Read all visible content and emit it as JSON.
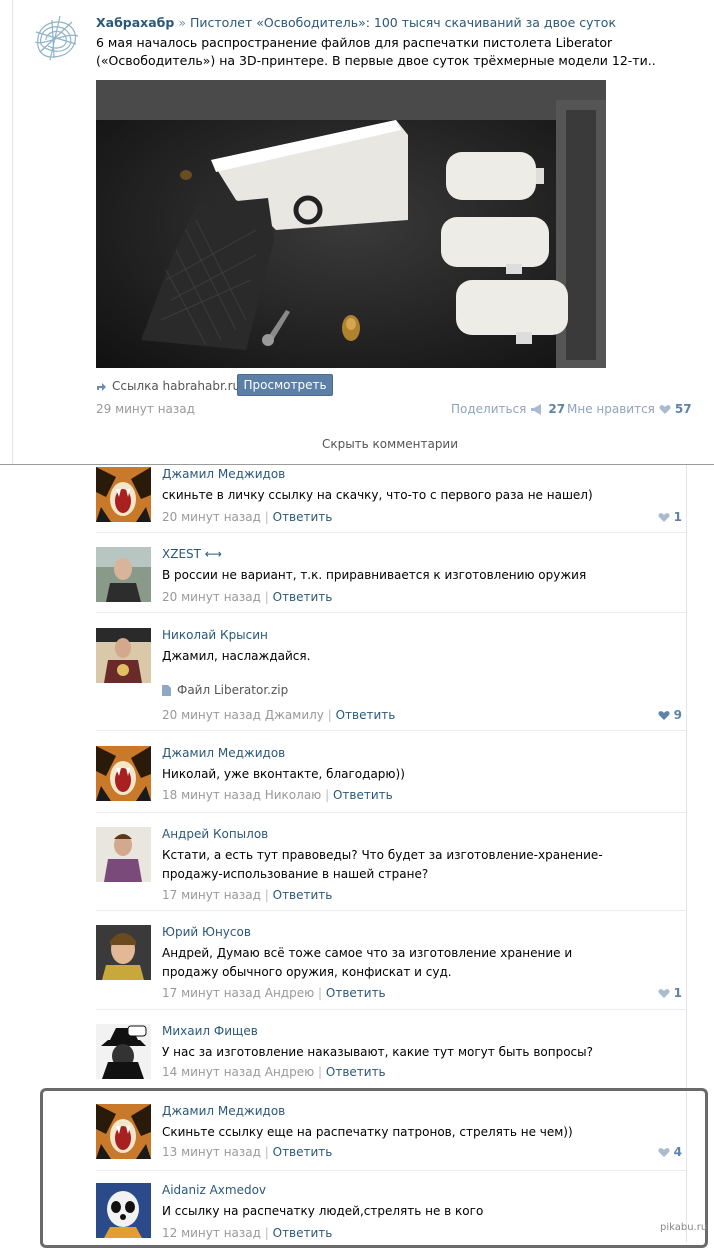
{
  "post": {
    "author": "Хабрахабр",
    "separator": "»",
    "title": "Пистолет «Освободитель»: 100 тысяч скачиваний за двое суток",
    "text": "6 мая началось распространение файлов для распечатки пистолета Liberator («Освободитель») на 3D-принтере. В первые двое суток трёхмерные модели 12-ти..",
    "link_label": "Ссылка habrahabr.ru",
    "view_button": "Просмотреть",
    "time": "29 минут назад",
    "share_label": "Поделиться",
    "share_count": "27",
    "like_label": "Мне нравится",
    "like_count": "57",
    "hide_comments": "Скрыть комментарии"
  },
  "comments": [
    {
      "name": "Джамил Меджидов",
      "text": "скиньте в личку ссылку на скачку, что-то с первого раза не нашел)",
      "time": "20 минут назад",
      "reply": "Ответить",
      "likes": "1"
    },
    {
      "name": "XZEST ⟷",
      "text": "В россии не вариант, т.к. приравнивается к изготовлению оружия",
      "time": "20 минут назад",
      "reply": "Ответить"
    },
    {
      "name": "Николай Крысин",
      "text": "Джамил, наслаждайся.",
      "file": "Файл Liberator.zip",
      "time": "20 минут назад Джамилу",
      "reply": "Ответить",
      "likes": "9"
    },
    {
      "name": "Джамил Меджидов",
      "text": "Николай, уже вконтакте, благодарю))",
      "time": "18 минут назад Николаю",
      "reply": "Ответить"
    },
    {
      "name": "Андрей Копылов",
      "text": "Кстати, а есть тут правоведы? Что будет за изготовление-хранение-продажу-использование в нашей стране?",
      "time": "17 минут назад",
      "reply": "Ответить"
    },
    {
      "name": "Юрий Юнусов",
      "text": "Андрей, Думаю всё тоже самое что за изготовление хранение и продажу обычного оружия, конфискат и суд.",
      "time": "17 минут назад Андрею",
      "reply": "Ответить",
      "likes": "1"
    },
    {
      "name": "Михаил Фищев",
      "text": "У нас за изготовление наказывают, какие тут могут быть вопросы?",
      "time": "14 минут назад Андрею",
      "reply": "Ответить"
    },
    {
      "name": "Джамил Меджидов",
      "text": "Скиньте ссылку еще на распечатку патронов, стрелять не чем))",
      "time": "13 минут назад",
      "reply": "Ответить",
      "likes": "4"
    },
    {
      "name": "Aidaniz Axmedov",
      "text": "И ссылку на распечатку людей,стрелять не в кого",
      "time": "12 минут назад",
      "reply": "Ответить"
    }
  ],
  "watermark": "pikabu.ru",
  "colors": {
    "link": "#2b587a",
    "button": "#5b7fa6",
    "meta": "#999999",
    "like": "#5e82a8"
  }
}
